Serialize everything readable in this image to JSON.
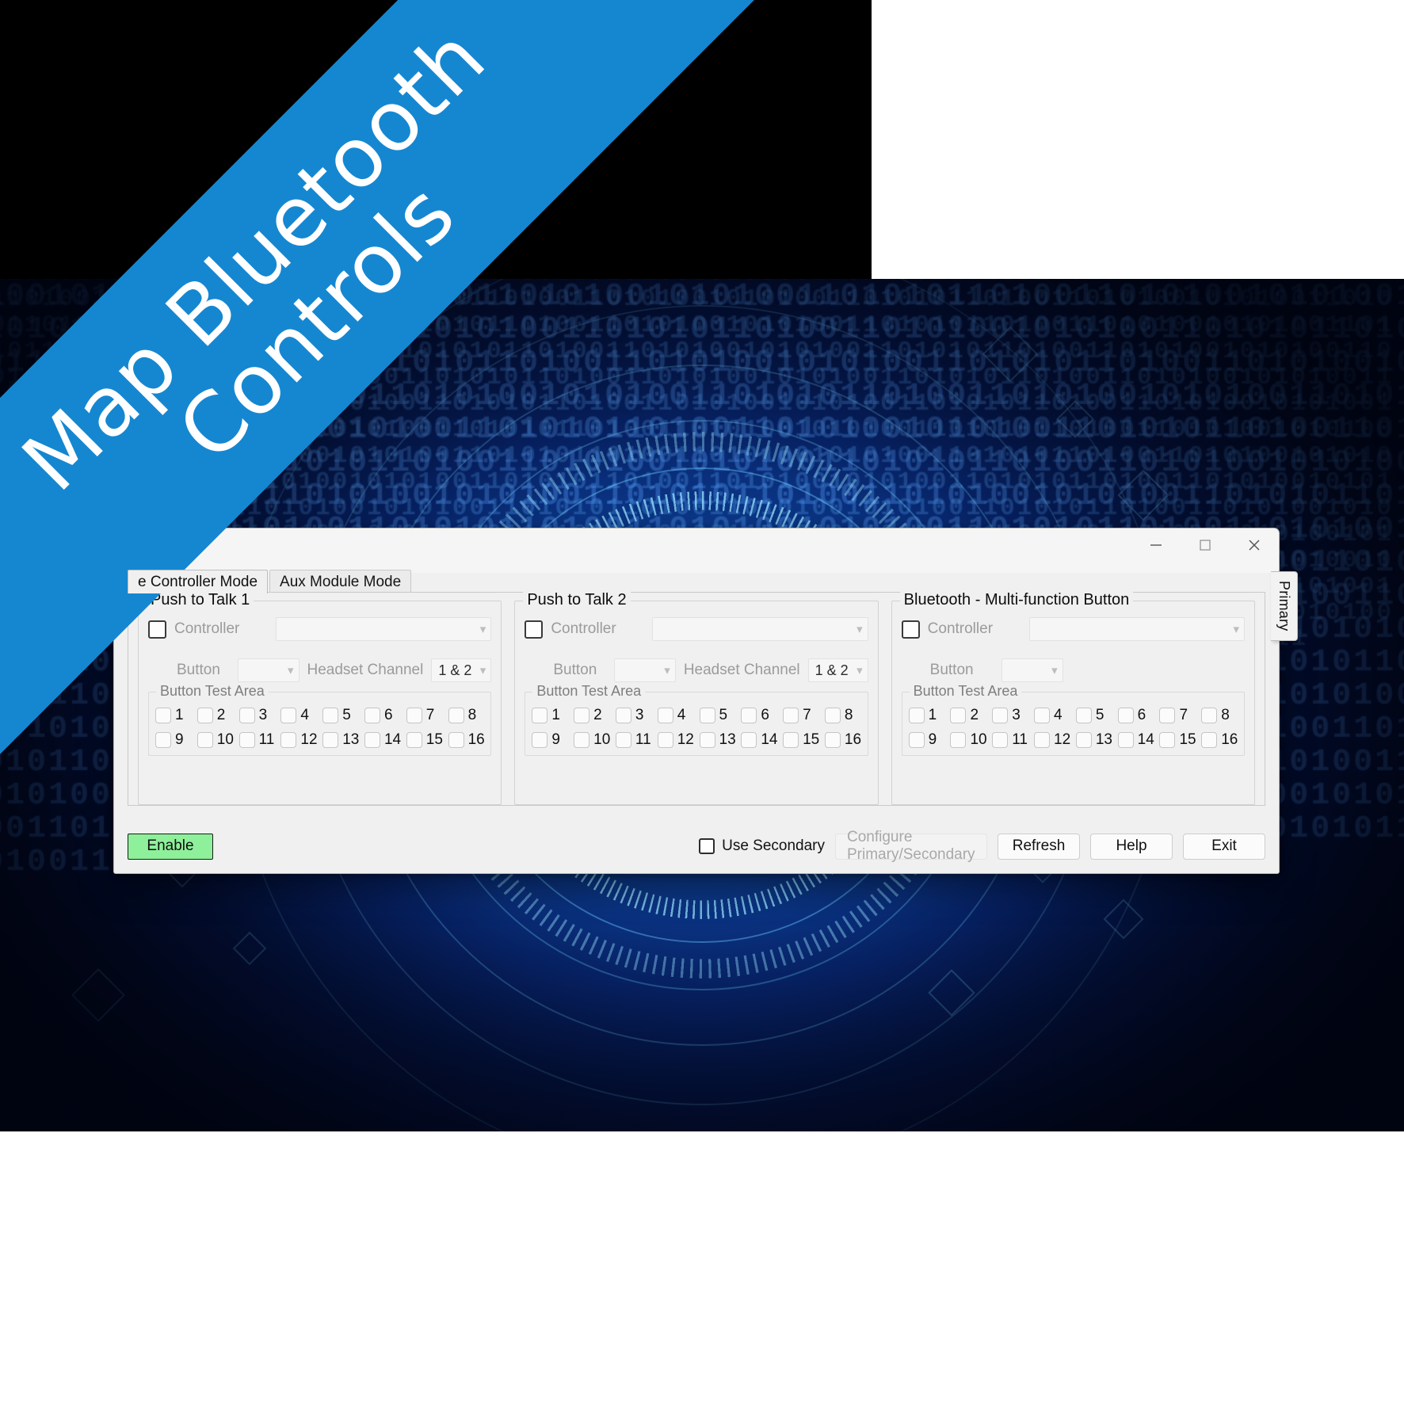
{
  "banner": {
    "text": "Map Bluetooth\nControls",
    "color": "#1587d1"
  },
  "window": {
    "controls": {
      "minimize": "minimize-icon",
      "maximize": "maximize-icon",
      "close": "close-icon"
    },
    "side_tab": "Primary",
    "tabs": [
      {
        "label": "e Controller Mode",
        "active": true
      },
      {
        "label": "Aux Module Mode",
        "active": false
      }
    ],
    "panels": [
      {
        "legend": "Push to Talk 1",
        "controller_label": "Controller",
        "controller_value": "",
        "button_label": "Button",
        "button_value": "",
        "headset_label": "Headset Channel",
        "headset_value": "1 & 2",
        "has_headset": true,
        "test_area_legend": "Button Test Area",
        "test_buttons_row1": [
          "1",
          "2",
          "3",
          "4",
          "5",
          "6",
          "7",
          "8"
        ],
        "test_buttons_row2": [
          "9",
          "10",
          "11",
          "12",
          "13",
          "14",
          "15",
          "16"
        ]
      },
      {
        "legend": "Push to Talk 2",
        "controller_label": "Controller",
        "controller_value": "",
        "button_label": "Button",
        "button_value": "",
        "headset_label": "Headset Channel",
        "headset_value": "1 & 2",
        "has_headset": true,
        "test_area_legend": "Button Test Area",
        "test_buttons_row1": [
          "1",
          "2",
          "3",
          "4",
          "5",
          "6",
          "7",
          "8"
        ],
        "test_buttons_row2": [
          "9",
          "10",
          "11",
          "12",
          "13",
          "14",
          "15",
          "16"
        ]
      },
      {
        "legend": "Bluetooth - Multi-function Button",
        "controller_label": "Controller",
        "controller_value": "",
        "button_label": "Button",
        "button_value": "",
        "headset_label": "",
        "headset_value": "",
        "has_headset": false,
        "test_area_legend": "Button Test Area",
        "test_buttons_row1": [
          "1",
          "2",
          "3",
          "4",
          "5",
          "6",
          "7",
          "8"
        ],
        "test_buttons_row2": [
          "9",
          "10",
          "11",
          "12",
          "13",
          "14",
          "15",
          "16"
        ]
      }
    ],
    "footer": {
      "enable_label": "Enable",
      "enable_color": "#8ef09a",
      "use_secondary_label": "Use Secondary",
      "configure_label": "Configure Primary/Secondary",
      "refresh_label": "Refresh",
      "help_label": "Help",
      "exit_label": "Exit"
    }
  },
  "background": {
    "binary_text": "0110101011010100110101011001010100110101001010100110101011010011010100101010011010101101001101010010101001101010110100110101001010100110101011010011010100101010011010101101001101010010101001101010110100110101001010100110101011010011010100101010011010101101001101010010101001101010110100110101001010100110101011010011010100101010011010101101001101010010101001101010110100110101001010100110101011010011010100101010011010101101001101010010101001101010110100110101001010100110101011010011010100101010011010101101001101010010101001101010110100110101001010100110101011010011010100101010011010101101001101010010101001101010110100110101001010100110101011010011010100101010011010101101001101010010101001101010110100110101001010100110101011010011010100101010011010101101001101010010101001101010110100110101001010100110101011010011010100101010011010101101001101010010101001101010110100110101001010100110101011010011010100101010011010101101001101010010101001101010110100110101001010100110101011010011010100101010011010101101001101010010101001101010110100110101001010100110101011010011010100101010011010101101001101010010101001101010110100110101001010100110101011010011010100101010011010101101001101010010101001101010110100110101001010100110101011010011"
  }
}
